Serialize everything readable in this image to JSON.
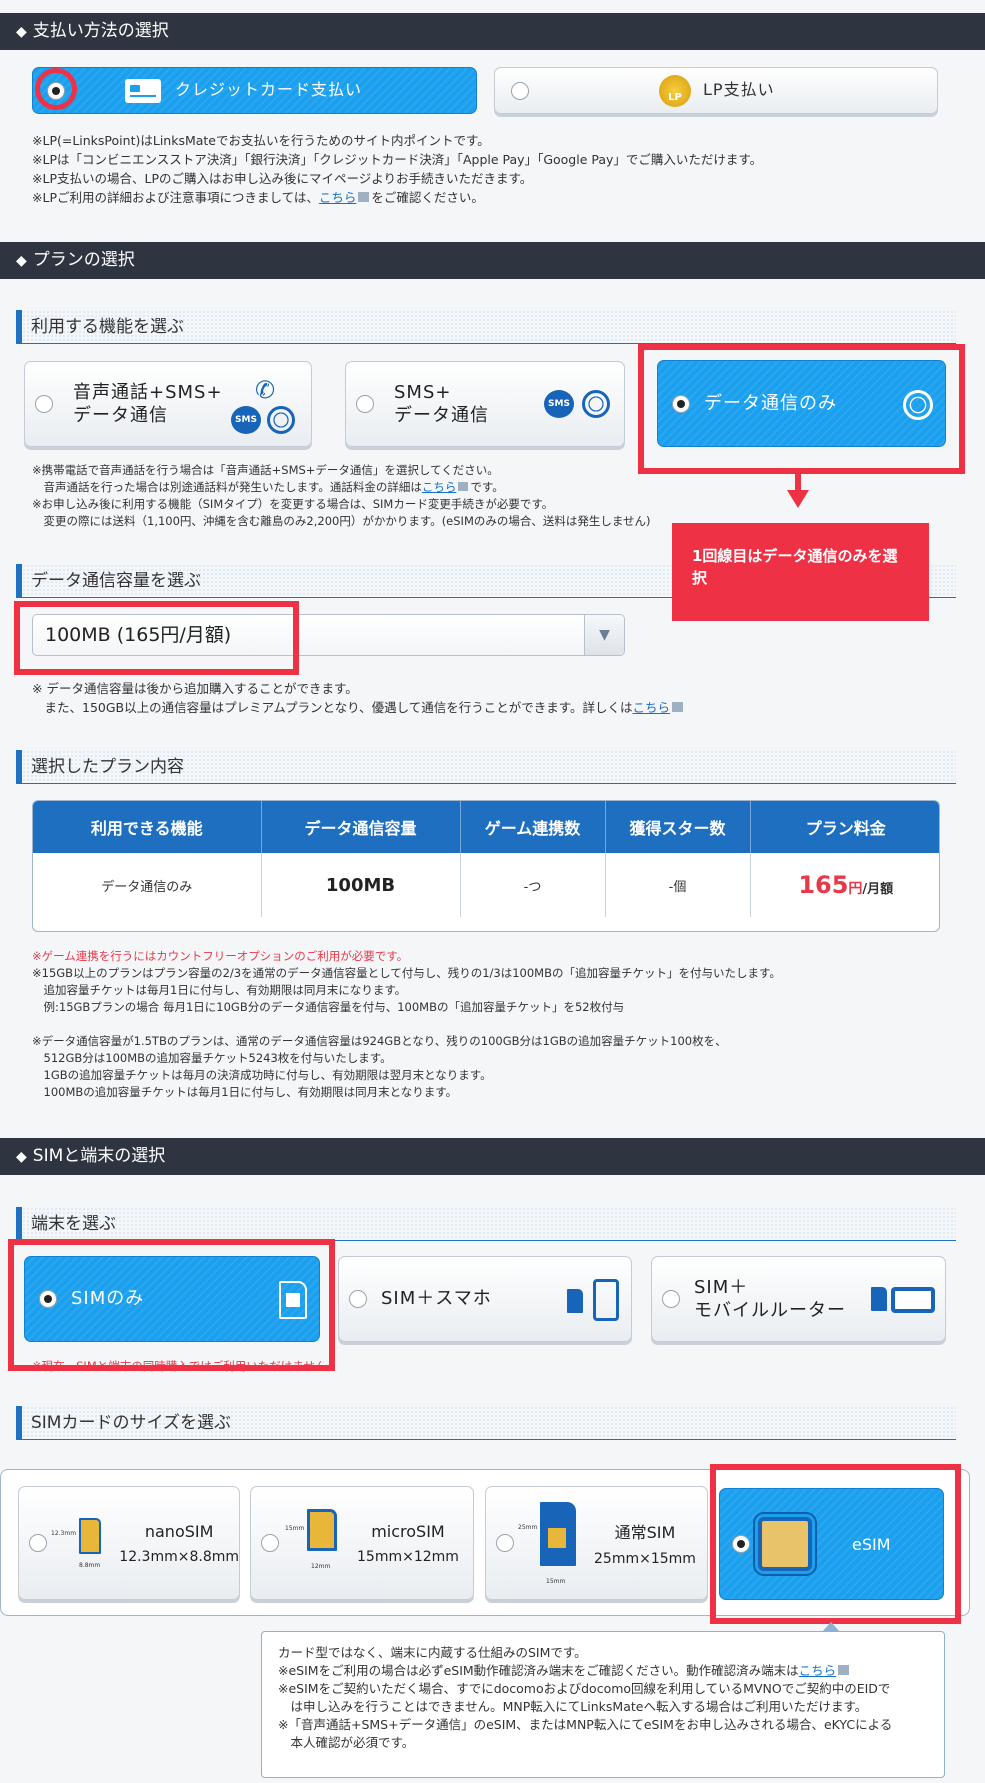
{
  "payment": {
    "section_title": "支払い方法の選択",
    "options": [
      {
        "label": "クレジットカード支払い",
        "selected": true
      },
      {
        "label": "LP支払い",
        "selected": false
      }
    ],
    "lp_badge": "LP",
    "notes": [
      "※LP(=LinksPoint)はLinksMateでお支払いを行うためのサイト内ポイントです。",
      "※LPは「コンビニエンスストア決済」「銀行決済」「クレジットカード決済」「Apple Pay」「Google Pay」でご購入いただけます。",
      "※LP支払いの場合、LPのご購入はお申し込み後にマイページよりお手続きいただきます。"
    ],
    "note4_pre": "※LPご利用の詳細および注意事項につきましては、",
    "note4_link": "こちら",
    "note4_post": "をご確認ください。"
  },
  "plan": {
    "section_title": "プランの選択",
    "function_title": "利用する機能を選ぶ",
    "functions": [
      {
        "label_line1": "音声通話+SMS+",
        "label_line2": "データ通信",
        "selected": false
      },
      {
        "label_line1": "SMS+",
        "label_line2": "データ通信",
        "selected": false
      },
      {
        "label_line1": "データ通信のみ",
        "label_line2": "",
        "selected": true
      }
    ],
    "sms_badge": "SMS",
    "notes_line1": "※携帯電話で音声通話を行う場合は「音声通話+SMS+データ通信」を選択してください。",
    "notes_line2_pre": "　音声通話を行った場合は別途通話料が発生いたします。通話料金の詳細は",
    "notes_line2_link": "こちら",
    "notes_line2_post": "です。",
    "notes_line3": "※お申し込み後に利用する機能（SIMタイプ）を変更する場合は、SIMカード変更手続きが必要です。",
    "notes_line4": "　変更の際には送料（1,100円、沖縄を含む離島のみ2,200円）がかかります。(eSIMのみの場合、送料は発生しません)",
    "callout": "1回線目はデータ通信のみを選択",
    "capacity_title": "データ通信容量を選ぶ",
    "capacity_value": "100MB (165円/月額)",
    "capacity_note1": "※ データ通信容量は後から追加購入することができます。",
    "capacity_note2_pre": "　また、150GB以上の通信容量はプレミアムプランとなり、優遇して通信を行うことができます。詳しくは",
    "capacity_note2_link": "こちら",
    "selected_title": "選択したプラン内容",
    "table_headers": [
      "利用できる機能",
      "データ通信容量",
      "ゲーム連携数",
      "獲得スター数",
      "プラン料金"
    ],
    "table_row": {
      "function": "データ通信のみ",
      "capacity": "100MB",
      "games": "-つ",
      "stars": "-個",
      "price": "165",
      "price_unit": "円",
      "price_suffix": "/月額"
    },
    "red_note": "※ゲーム連携を行うにはカウントフリーオプションのご利用が必要です。",
    "notes_a": [
      "※15GB以上のプランはプラン容量の2/3を通常のデータ通信容量として付与し、残りの1/3は100MBの「追加容量チケット」を付与いたします。",
      "　追加容量チケットは毎月1日に付与し、有効期限は同月末になります。",
      "　例:15GBプランの場合 毎月1日に10GB分のデータ通信容量を付与、100MBの「追加容量チケット」を52枚付与"
    ],
    "notes_b": [
      "※データ通信容量が1.5TBのプランは、通常のデータ通信容量は924GBとなり、残りの100GB分は1GBの追加容量チケット100枚を、",
      "　512GB分は100MBの追加容量チケット5243枚を付与いたします。",
      "　1GBの追加容量チケットは毎月の決済成功時に付与し、有効期限は翌月末となります。",
      "　100MBの追加容量チケットは毎月1日に付与し、有効期限は同月末となります。"
    ]
  },
  "sim": {
    "section_title": "SIMと端末の選択",
    "device_title": "端末を選ぶ",
    "devices": [
      {
        "label_line1": "SIMのみ",
        "label_line2": "",
        "selected": true
      },
      {
        "label_line1": "SIM＋スマホ",
        "label_line2": "",
        "selected": false
      },
      {
        "label_line1": "SIM＋",
        "label_line2": "モバイルルーター",
        "selected": false
      }
    ],
    "device_red_note": "※現在、SIMと端末の同時購入ではご利用いただけません。",
    "size_title": "SIMカードのサイズを選ぶ",
    "sizes": [
      {
        "name": "nanoSIM",
        "dims": "12.3mm×8.8mm",
        "dim_h": "12.3mm",
        "dim_w": "8.8mm",
        "selected": false
      },
      {
        "name": "microSIM",
        "dims": "15mm×12mm",
        "dim_h": "15mm",
        "dim_w": "12mm",
        "selected": false
      },
      {
        "name": "通常SIM",
        "dims": "25mm×15mm",
        "dim_h": "25mm",
        "dim_w": "15mm",
        "selected": false
      },
      {
        "name": "eSIM",
        "dims": "",
        "dim_h": "",
        "dim_w": "",
        "selected": true
      }
    ],
    "esim_notes": [
      "カード型ではなく、端末に内蔵する仕組みのSIMです。",
      "※eSIMをご利用の場合は必ずeSIM動作確認済み端末をご確認ください。動作確認済み端末は",
      "※eSIMをご契約いただく場合、すでにdocomoおよびdocomo回線を利用しているMVNOでご契約中のEIDで",
      "　は申し込みを行うことはできません。MNP転入にてLinksMateへ転入する場合はご利用いただけます。",
      "※「音声通話+SMS+データ通信」のeSIM、またはMNP転入にてeSIMをお申し込みされる場合、eKYCによる",
      "　本人確認が必須です。"
    ],
    "esim_link": "こちら"
  },
  "colors": {
    "accent": "#1aa0ee",
    "header_bg": "#2e3540",
    "annotation_red": "#ef3145",
    "price_red": "#e63a4a"
  }
}
